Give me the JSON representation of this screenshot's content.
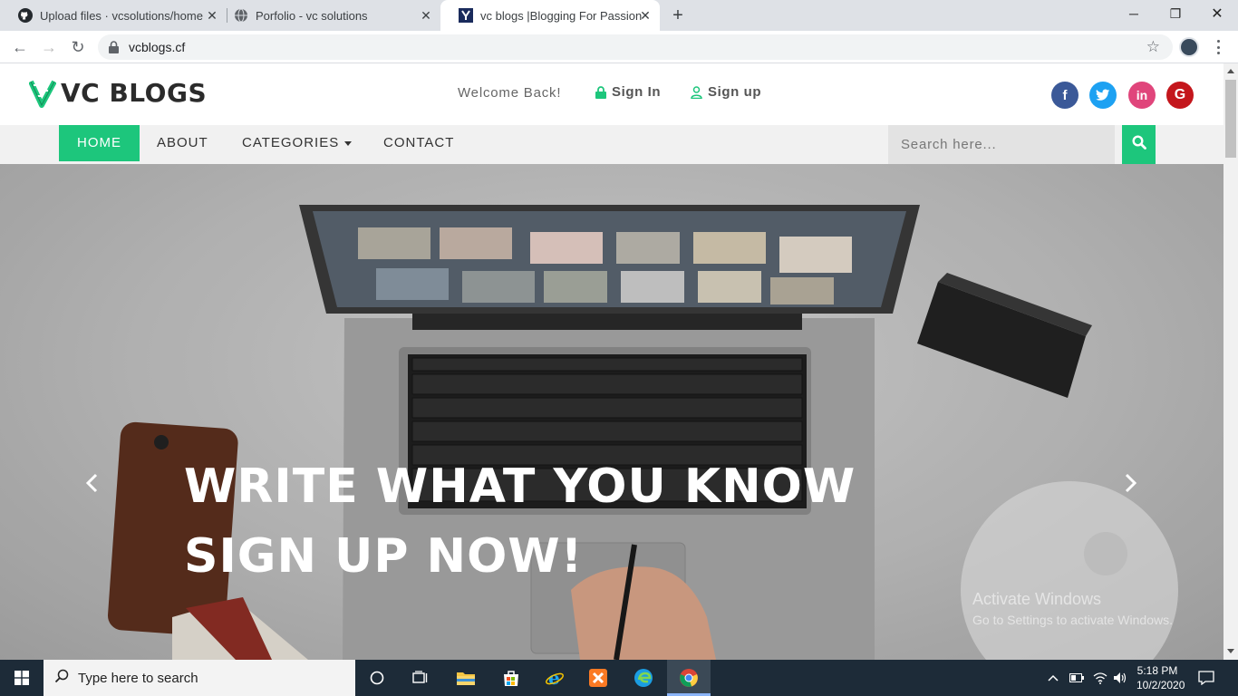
{
  "browser": {
    "tabs": [
      {
        "title": "Upload files · vcsolutions/home",
        "favicon": "github-icon"
      },
      {
        "title": "Porfolio - vc solutions",
        "favicon": "globe-icon"
      },
      {
        "title": "vc blogs |Blogging For Passion",
        "favicon": "vc-favicon"
      }
    ],
    "active_tab": 2,
    "url": "vcblogs.cf"
  },
  "site": {
    "logo_text": "VC BLOGS",
    "welcome": "Welcome Back!",
    "sign_in": "Sign In",
    "sign_up": "Sign up",
    "social": [
      {
        "name": "facebook",
        "glyph": "f",
        "color": "#3b5998"
      },
      {
        "name": "twitter",
        "glyph": "t",
        "color": "#1da1f2"
      },
      {
        "name": "linkedin",
        "glyph": "in",
        "color": "#e0457b"
      },
      {
        "name": "google",
        "glyph": "G",
        "color": "#c4161c"
      }
    ],
    "nav": {
      "home": "HOME",
      "about": "ABOUT",
      "categories": "CATEGORIES",
      "contact": "CONTACT"
    },
    "search_placeholder": "Search here...",
    "accent": "#1dc67c"
  },
  "hero": {
    "line1": "WRITE WHAT YOU KNOW",
    "line2": "SIGN UP NOW!"
  },
  "watermark": {
    "title": "Activate Windows",
    "subtitle": "Go to Settings to activate Windows."
  },
  "taskbar": {
    "search_placeholder": "Type here to search",
    "time": "5:18 PM",
    "date": "10/2/2020"
  }
}
